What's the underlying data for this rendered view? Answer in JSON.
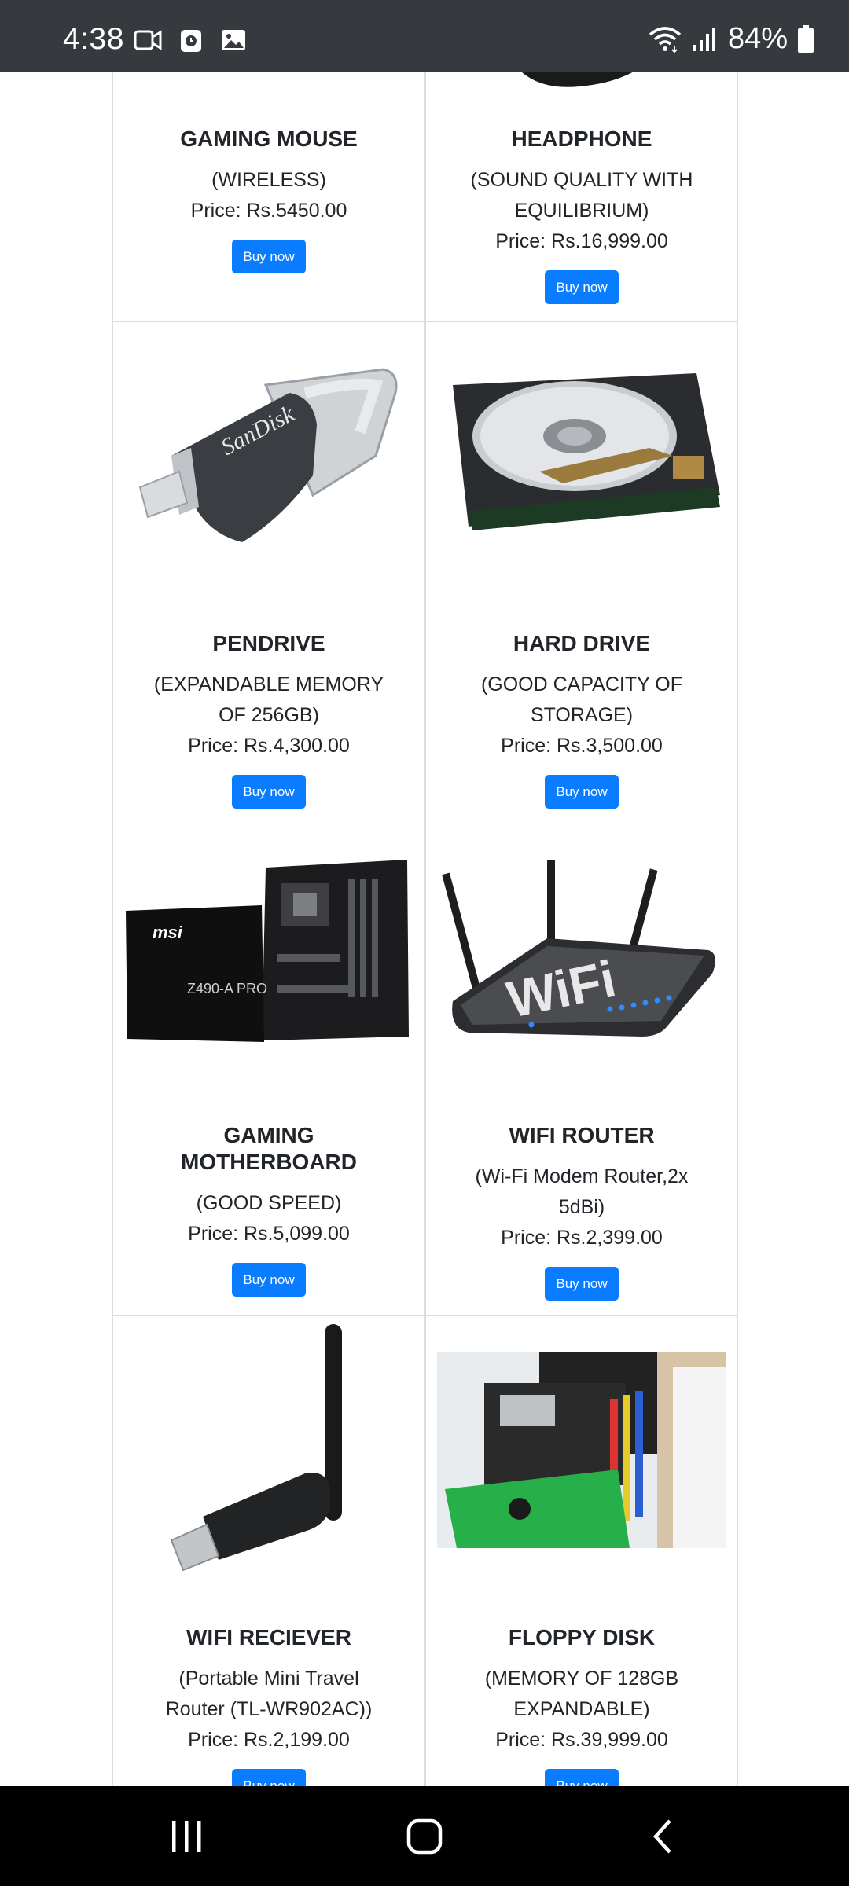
{
  "status_bar": {
    "time": "4:38",
    "battery": "84%",
    "icons": [
      "video-call-icon",
      "clock-app-icon",
      "gallery-icon",
      "wifi-icon",
      "signal-icon",
      "battery-icon"
    ]
  },
  "products": [
    {
      "name": "GAMING MOUSE",
      "desc": "(WIRELESS)",
      "price": "Price: Rs.5450.00",
      "button": "Buy now"
    },
    {
      "name": "HEADPHONE",
      "desc": "(SOUND QUALITY WITH EQUILIBRIUM)",
      "price": "Price: Rs.16,999.00",
      "button": "Buy now"
    },
    {
      "name": "PENDRIVE",
      "desc": "(EXPANDABLE MEMORY OF 256GB)",
      "price": "Price: Rs.4,300.00",
      "button": "Buy now",
      "brand": "SanDisk"
    },
    {
      "name": "HARD DRIVE",
      "desc": "(GOOD CAPACITY OF STORAGE)",
      "price": "Price: Rs.3,500.00",
      "button": "Buy now"
    },
    {
      "name": "GAMING MOTHERBOARD",
      "desc": "(GOOD SPEED)",
      "price": "Price: Rs.5,099.00",
      "button": "Buy now",
      "brand": "msi",
      "model": "Z490-A PRO"
    },
    {
      "name": "WIFI ROUTER",
      "desc": "(Wi-Fi Modem Router,2x 5dBi)",
      "price": "Price: Rs.2,399.00",
      "button": "Buy now",
      "logo": "WiFi"
    },
    {
      "name": "WIFI RECIEVER",
      "desc": "(Portable Mini Travel Router (TL-WR902AC))",
      "price": "Price: Rs.2,199.00",
      "button": "Buy now"
    },
    {
      "name": "FLOPPY DISK",
      "desc": "(MEMORY OF 128GB EXPANDABLE)",
      "price": "Price: Rs.39,999.00",
      "button": "Buy now"
    }
  ],
  "colors": {
    "status_bar": "#36393d",
    "button": "#0a7cff",
    "nav_bar": "#000000"
  }
}
